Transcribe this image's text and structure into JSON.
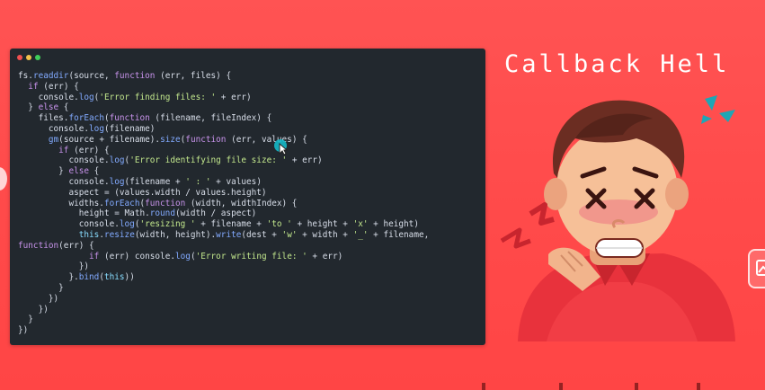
{
  "headline": "Callback Hell",
  "window_dots": [
    "#f05050",
    "#f2c14b",
    "#3fcf5a"
  ],
  "code_lines": [
    [
      [
        "p",
        "fs."
      ],
      [
        "f",
        "readdir"
      ],
      [
        "p",
        "(source, "
      ],
      [
        "k",
        "function"
      ],
      [
        "p",
        " (err, files) {"
      ]
    ],
    [
      [
        "p",
        "  "
      ],
      [
        "k",
        "if"
      ],
      [
        "p",
        " (err) {"
      ]
    ],
    [
      [
        "p",
        "    console."
      ],
      [
        "f",
        "log"
      ],
      [
        "p",
        "("
      ],
      [
        "s",
        "'Error finding files: '"
      ],
      [
        "p",
        " + err)"
      ]
    ],
    [
      [
        "p",
        "  } "
      ],
      [
        "k",
        "else"
      ],
      [
        "p",
        " {"
      ]
    ],
    [
      [
        "p",
        "    files."
      ],
      [
        "f",
        "forEach"
      ],
      [
        "p",
        "("
      ],
      [
        "k",
        "function"
      ],
      [
        "p",
        " (filename, fileIndex) {"
      ]
    ],
    [
      [
        "p",
        "      console."
      ],
      [
        "f",
        "log"
      ],
      [
        "p",
        "(filename)"
      ]
    ],
    [
      [
        "p",
        "      "
      ],
      [
        "f",
        "gm"
      ],
      [
        "p",
        "(source + filename)."
      ],
      [
        "f",
        "size"
      ],
      [
        "p",
        "("
      ],
      [
        "k",
        "function"
      ],
      [
        "p",
        " (err, values) {"
      ]
    ],
    [
      [
        "p",
        "        "
      ],
      [
        "k",
        "if"
      ],
      [
        "p",
        " (err) {"
      ]
    ],
    [
      [
        "p",
        "          console."
      ],
      [
        "f",
        "log"
      ],
      [
        "p",
        "("
      ],
      [
        "s",
        "'Error identifying file size: '"
      ],
      [
        "p",
        " + err)"
      ]
    ],
    [
      [
        "p",
        "        } "
      ],
      [
        "k",
        "else"
      ],
      [
        "p",
        " {"
      ]
    ],
    [
      [
        "p",
        "          console."
      ],
      [
        "f",
        "log"
      ],
      [
        "p",
        "(filename + "
      ],
      [
        "s",
        "' : '"
      ],
      [
        "p",
        " + values)"
      ]
    ],
    [
      [
        "p",
        "          aspect = (values.width / values.height)"
      ]
    ],
    [
      [
        "p",
        "          widths."
      ],
      [
        "f",
        "forEach"
      ],
      [
        "p",
        "("
      ],
      [
        "k",
        "function"
      ],
      [
        "p",
        " (width, widthIndex) {"
      ]
    ],
    [
      [
        "p",
        "            height = Math."
      ],
      [
        "f",
        "round"
      ],
      [
        "p",
        "(width / aspect)"
      ]
    ],
    [
      [
        "p",
        "            console."
      ],
      [
        "f",
        "log"
      ],
      [
        "p",
        "("
      ],
      [
        "s",
        "'resizing '"
      ],
      [
        "p",
        " + filename + "
      ],
      [
        "s",
        "'to '"
      ],
      [
        "p",
        " + height + "
      ],
      [
        "s",
        "'x'"
      ],
      [
        "p",
        " + height)"
      ]
    ],
    [
      [
        "p",
        "            "
      ],
      [
        "v",
        "this"
      ],
      [
        "p",
        "."
      ],
      [
        "f",
        "resize"
      ],
      [
        "p",
        "(width, height)."
      ],
      [
        "f",
        "write"
      ],
      [
        "p",
        "(dest + "
      ],
      [
        "s",
        "'w'"
      ],
      [
        "p",
        " + width + "
      ],
      [
        "s",
        "'_'"
      ],
      [
        "p",
        " + filename,"
      ]
    ],
    [
      [
        "k",
        "function"
      ],
      [
        "p",
        "(err) {"
      ]
    ],
    [
      [
        "p",
        "              "
      ],
      [
        "k",
        "if"
      ],
      [
        "p",
        " (err) console."
      ],
      [
        "f",
        "log"
      ],
      [
        "p",
        "("
      ],
      [
        "s",
        "'Error writing file: '"
      ],
      [
        "p",
        " + err)"
      ]
    ],
    [
      [
        "p",
        "            })"
      ]
    ],
    [
      [
        "p",
        "          }."
      ],
      [
        "f",
        "bind"
      ],
      [
        "p",
        "("
      ],
      [
        "v",
        "this"
      ],
      [
        "p",
        "))"
      ]
    ],
    [
      [
        "p",
        "        }"
      ]
    ],
    [
      [
        "p",
        "      })"
      ]
    ],
    [
      [
        "p",
        "    })"
      ]
    ],
    [
      [
        "p",
        "  }"
      ]
    ],
    [
      [
        "p",
        "})"
      ]
    ]
  ]
}
